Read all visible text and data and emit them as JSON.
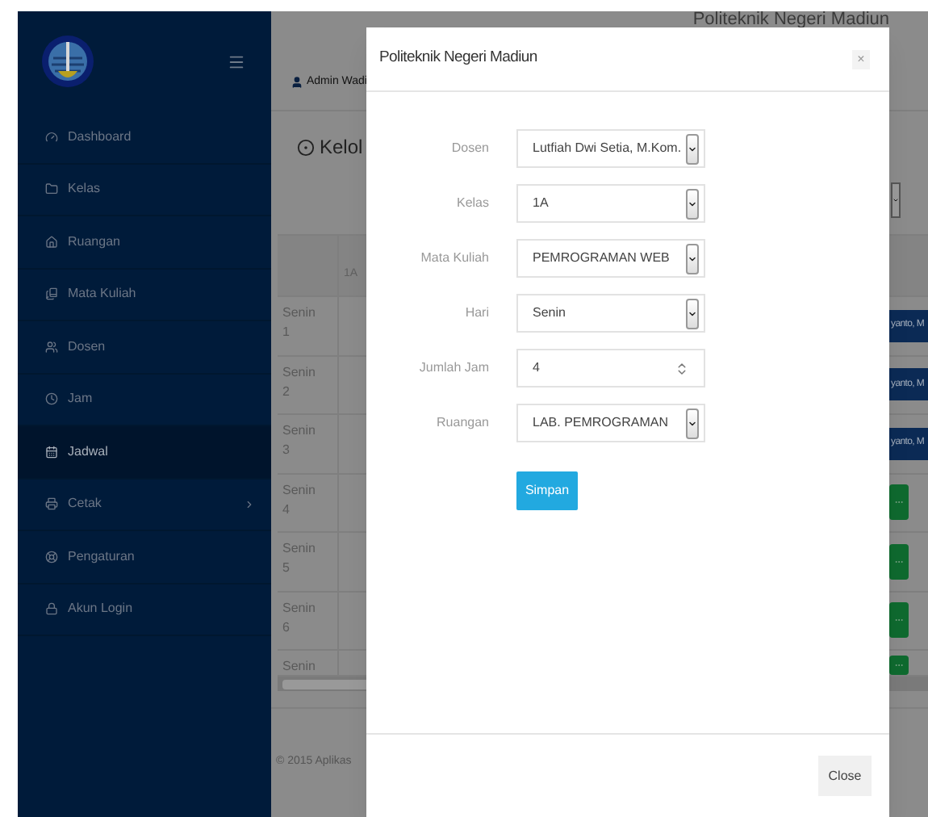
{
  "header": {
    "title": "Politeknik Negeri Madiun",
    "user": "Admin Wadi"
  },
  "sidebar": {
    "items": [
      {
        "label": "Dashboard",
        "selected": false,
        "has_submenu": false
      },
      {
        "label": "Kelas",
        "selected": false,
        "has_submenu": false
      },
      {
        "label": "Ruangan",
        "selected": false,
        "has_submenu": false
      },
      {
        "label": "Mata Kuliah",
        "selected": false,
        "has_submenu": false
      },
      {
        "label": "Dosen",
        "selected": false,
        "has_submenu": false
      },
      {
        "label": "Jam",
        "selected": false,
        "has_submenu": false
      },
      {
        "label": "Jadwal",
        "selected": true,
        "has_submenu": false
      },
      {
        "label": "Cetak",
        "selected": false,
        "has_submenu": true
      },
      {
        "label": "Pengaturan",
        "selected": false,
        "has_submenu": false
      },
      {
        "label": "Akun Login",
        "selected": false,
        "has_submenu": false
      }
    ]
  },
  "page": {
    "heading": "Kelol"
  },
  "table": {
    "columns": [
      "1A"
    ],
    "rows": [
      {
        "label": "Senin 1",
        "cell": {
          "kind": "badge",
          "text": "yanto, M"
        }
      },
      {
        "label": "Senin 2",
        "cell": {
          "kind": "badge",
          "text": "yanto, M"
        }
      },
      {
        "label": "Senin 3",
        "cell": {
          "kind": "badge",
          "text": "yanto, M"
        }
      },
      {
        "label": "Senin 4",
        "cell": {
          "kind": "button"
        }
      },
      {
        "label": "Senin 5",
        "cell": {
          "kind": "button"
        }
      },
      {
        "label": "Senin 6",
        "cell": {
          "kind": "button"
        }
      },
      {
        "label": "Senin",
        "cell": {
          "kind": "button"
        }
      }
    ]
  },
  "footer": {
    "text": "© 2015 Aplikas"
  },
  "modal": {
    "title": "Politeknik Negeri Madiun",
    "close": "×",
    "fields": [
      {
        "label": "Dosen",
        "kind": "select",
        "value": "Lutfiah Dwi Setia, M.Kom."
      },
      {
        "label": "Kelas",
        "kind": "select",
        "value": "1A"
      },
      {
        "label": "Mata Kuliah",
        "kind": "select",
        "value": "PEMROGRAMAN WEB"
      },
      {
        "label": "Hari",
        "kind": "select",
        "value": "Senin"
      },
      {
        "label": "Jumlah Jam",
        "kind": "number",
        "value": "4"
      },
      {
        "label": "Ruangan",
        "kind": "select",
        "value": "LAB. PEMROGRAMAN"
      }
    ],
    "submit": "Simpan",
    "footer_button": "Close"
  }
}
